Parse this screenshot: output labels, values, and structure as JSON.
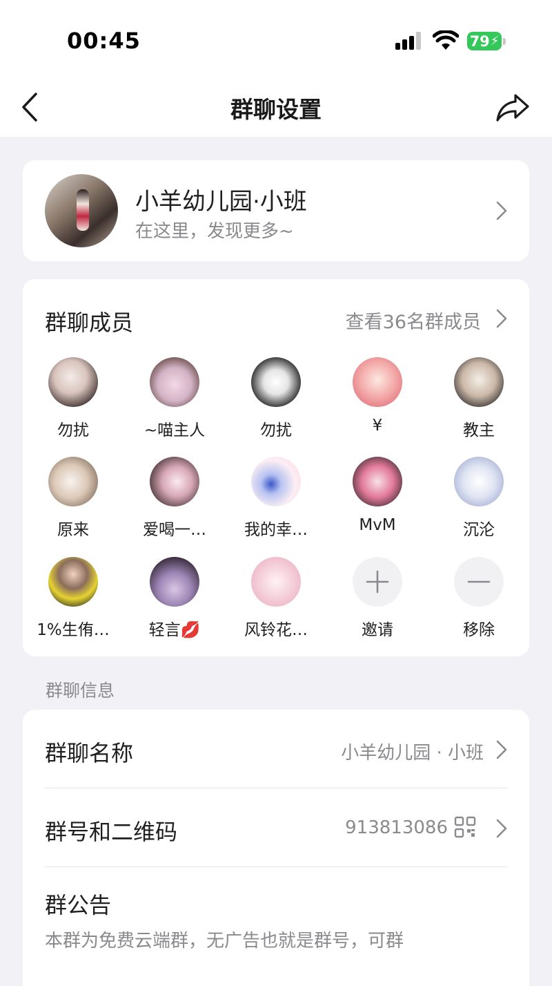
{
  "status": {
    "time": "00:45",
    "battery": "79"
  },
  "nav": {
    "title": "群聊设置",
    "back_icon": "chevron-left-icon",
    "share_icon": "share-arrow-icon"
  },
  "group": {
    "name": "小羊幼儿园·小班",
    "subtitle": "在这里，发现更多~"
  },
  "members": {
    "title": "群聊成员",
    "view_all": "查看36名群成员",
    "list": [
      {
        "name": "勿扰"
      },
      {
        "name": "~喵主人"
      },
      {
        "name": "勿扰"
      },
      {
        "name": "¥"
      },
      {
        "name": "教主"
      },
      {
        "name": "原来"
      },
      {
        "name": "爱喝一…"
      },
      {
        "name": "我的幸…"
      },
      {
        "name": "MvM"
      },
      {
        "name": "沉沦"
      },
      {
        "name": "1%生侑…"
      },
      {
        "name": "轻言💋"
      },
      {
        "name": "风铃花…"
      }
    ],
    "invite_label": "邀请",
    "remove_label": "移除"
  },
  "info": {
    "section_label": "群聊信息",
    "name_label": "群聊名称",
    "name_value": "小羊幼儿园 · 小班",
    "number_label": "群号和二维码",
    "number_value": "913813086",
    "notice_label": "群公告",
    "notice_text": "本群为免费云端群，无广告也就是群号，可群"
  },
  "colors": {
    "background": "#f2f2f6",
    "card": "#ffffff",
    "secondary_text": "#8a8a8e",
    "battery": "#34c759"
  }
}
